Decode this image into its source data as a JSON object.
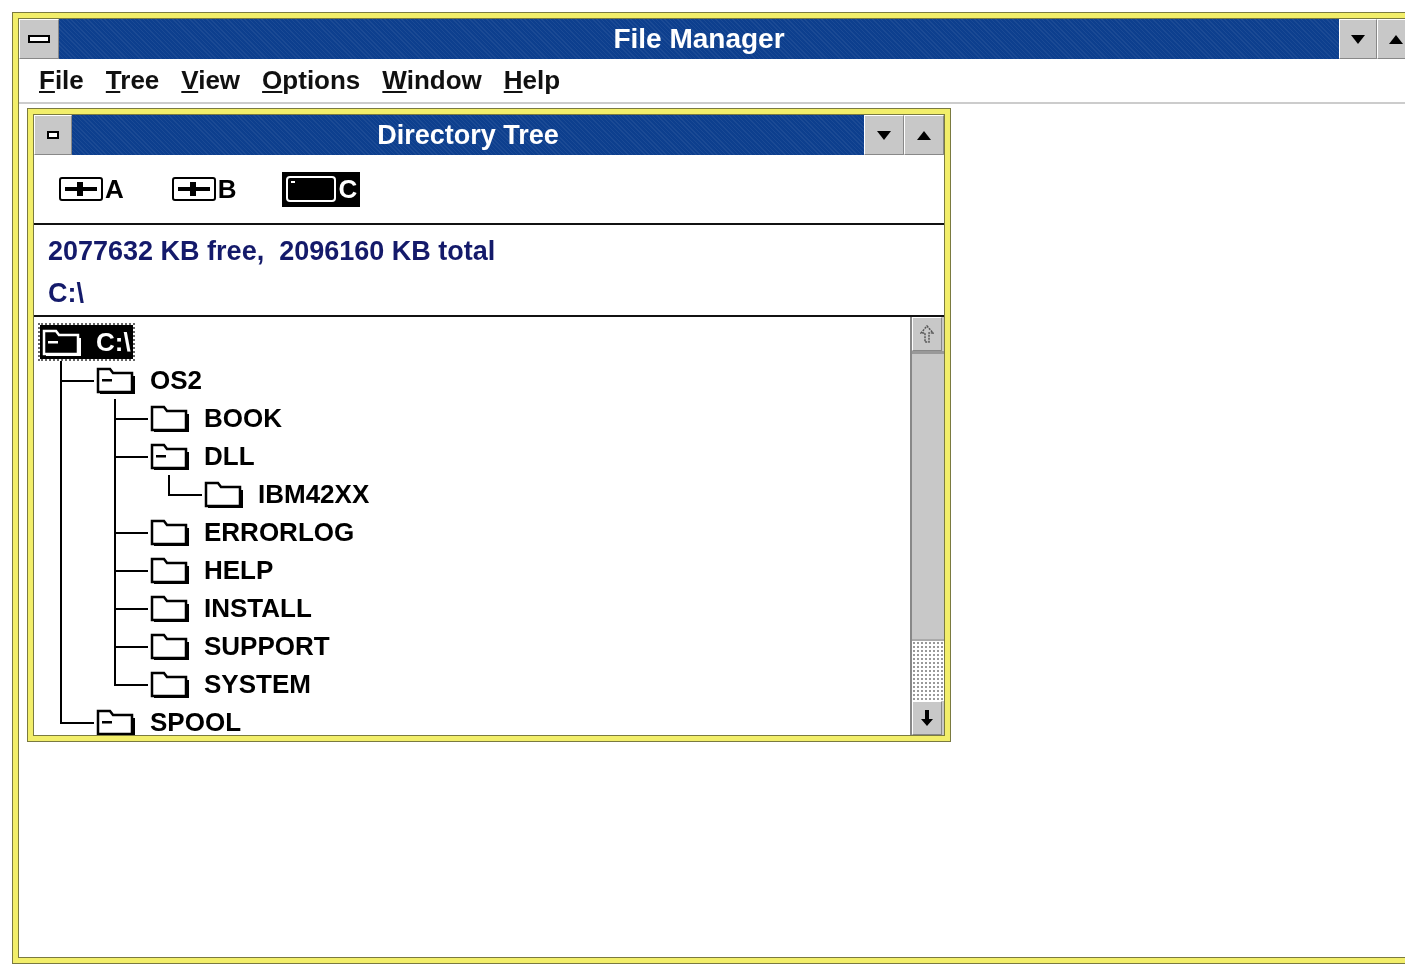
{
  "window": {
    "title": "File Manager"
  },
  "menu": [
    "File",
    "Tree",
    "View",
    "Options",
    "Window",
    "Help"
  ],
  "child_window": {
    "title": "Directory Tree",
    "drives": [
      {
        "letter": "A",
        "kind": "floppy",
        "selected": false
      },
      {
        "letter": "B",
        "kind": "floppy",
        "selected": false
      },
      {
        "letter": "C",
        "kind": "hard",
        "selected": true
      }
    ],
    "space": "2077632 KB free,  2096160 KB total",
    "path": "C:\\",
    "tree": {
      "label": "C:\\",
      "selected": true,
      "expanded": true,
      "children": [
        {
          "label": "OS2",
          "selected": false,
          "expanded": true,
          "children": [
            {
              "label": "BOOK",
              "selected": false,
              "expanded": false
            },
            {
              "label": "DLL",
              "selected": false,
              "expanded": true,
              "children": [
                {
                  "label": "IBM42XX",
                  "selected": false,
                  "expanded": false
                }
              ]
            },
            {
              "label": "ERRORLOG",
              "selected": false,
              "expanded": false
            },
            {
              "label": "HELP",
              "selected": false,
              "expanded": false
            },
            {
              "label": "INSTALL",
              "selected": false,
              "expanded": false
            },
            {
              "label": "SUPPORT",
              "selected": false,
              "expanded": false
            },
            {
              "label": "SYSTEM",
              "selected": false,
              "expanded": false
            }
          ]
        },
        {
          "label": "SPOOL",
          "selected": false,
          "expanded": true
        }
      ]
    }
  }
}
